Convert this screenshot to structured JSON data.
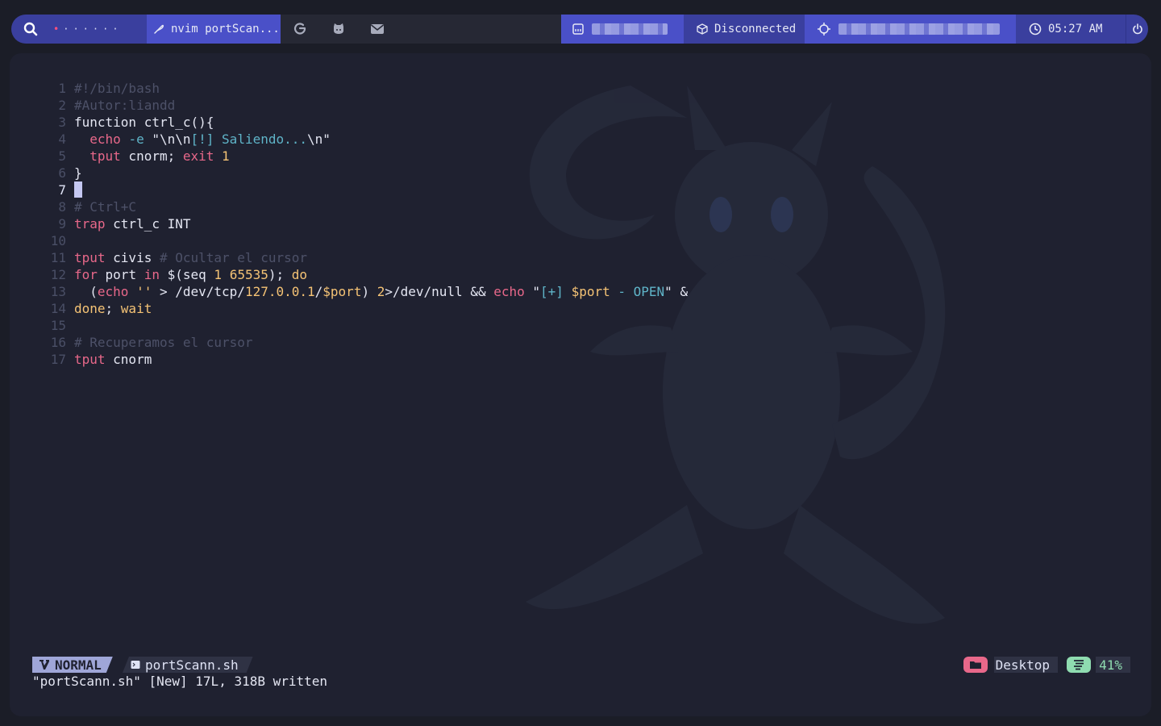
{
  "topbar": {
    "workspaces": "• · · · · · ·",
    "window_title": "nvim portScan...",
    "apps": [
      "google-icon",
      "github-icon",
      "mail-icon"
    ],
    "vpn_status": "Disconnected",
    "clock": "05:27 AM"
  },
  "editor": {
    "current_line": 7,
    "lines": [
      {
        "n": "1",
        "text": "#!/bin/bash"
      },
      {
        "n": "2",
        "text": "#Autor:liandd"
      },
      {
        "n": "3",
        "text": "function ctrl_c(){"
      },
      {
        "n": "4",
        "text": "  echo -e \"\\n\\n[!] Saliendo...\\n\""
      },
      {
        "n": "5",
        "text": "  tput cnorm; exit 1"
      },
      {
        "n": "6",
        "text": "}"
      },
      {
        "n": "7",
        "text": ""
      },
      {
        "n": "8",
        "text": "# Ctrl+C"
      },
      {
        "n": "9",
        "text": "trap ctrl_c INT"
      },
      {
        "n": "10",
        "text": ""
      },
      {
        "n": "11",
        "text": "tput civis # Ocultar el cursor"
      },
      {
        "n": "12",
        "text": "for port in $(seq 1 65535); do"
      },
      {
        "n": "13",
        "text": "  (echo '' > /dev/tcp/127.0.0.1/$port) 2>/dev/null && echo \"[+] $port - OPEN\" &"
      },
      {
        "n": "14",
        "text": "done; wait"
      },
      {
        "n": "15",
        "text": ""
      },
      {
        "n": "16",
        "text": "# Recuperamos el cursor"
      },
      {
        "n": "17",
        "text": "tput cnorm"
      }
    ]
  },
  "statusline": {
    "mode": "NORMAL",
    "filename": "portScann.sh",
    "directory": "Desktop",
    "percent": "41%"
  },
  "message": "\"portScann.sh\" [New] 17L, 318B written",
  "colors": {
    "accent_dark": "#3a3f9e",
    "accent": "#4a50c8",
    "keyword": "#e8688a",
    "number": "#f5c375",
    "string_special": "#5fb4c8",
    "comment": "#4d5168"
  }
}
